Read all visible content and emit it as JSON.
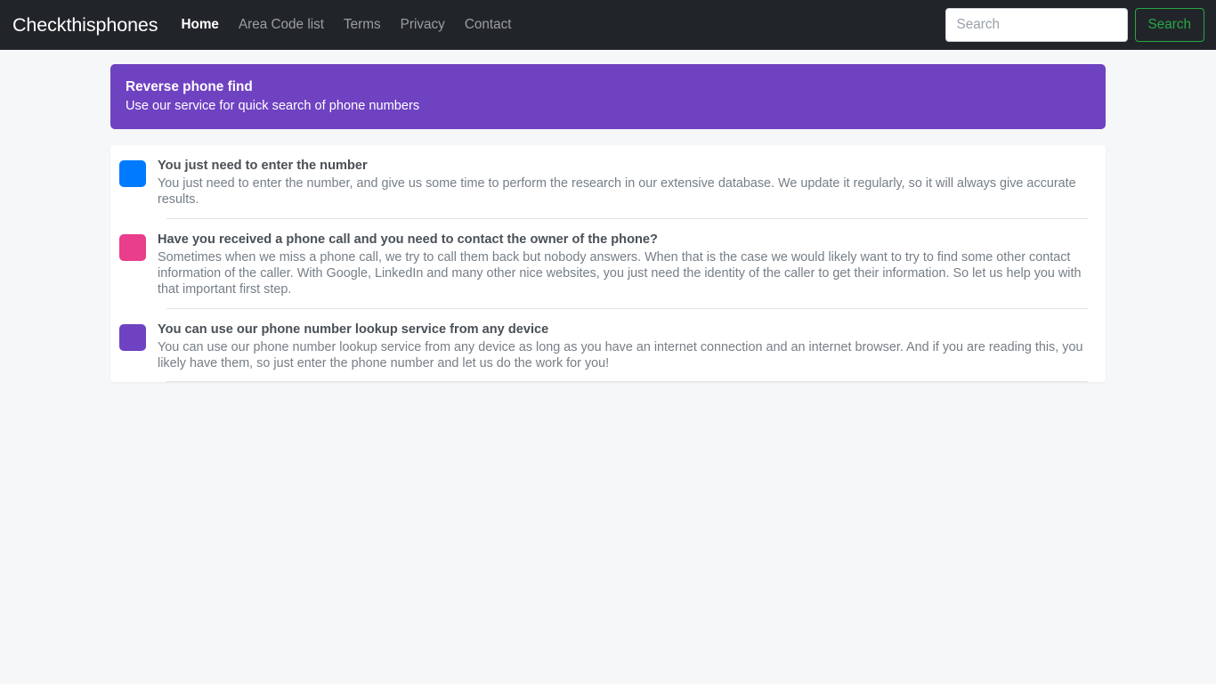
{
  "navbar": {
    "brand": "Checkthisphones",
    "links": [
      {
        "label": "Home",
        "active": true
      },
      {
        "label": "Area Code list",
        "active": false
      },
      {
        "label": "Terms",
        "active": false
      },
      {
        "label": "Privacy",
        "active": false
      },
      {
        "label": "Contact",
        "active": false
      }
    ],
    "search": {
      "value": "",
      "placeholder": "Search",
      "button_label": "Search"
    },
    "background_color": "#212529",
    "button_color": "#28a745"
  },
  "banner": {
    "title": "Reverse phone find",
    "subtitle": "Use our service for quick search of phone numbers",
    "background_color": "#6f42c1"
  },
  "card": {
    "blocks": [
      {
        "swatch_color": "#007bff",
        "swatch_name": "blue",
        "title": "You just need to enter the number",
        "text": "You just need to enter the number, and give us some time to perform the research in our extensive database. We update it regularly, so it will always give accurate results."
      },
      {
        "swatch_color": "#e83e8c",
        "swatch_name": "pink",
        "title": "Have you received a phone call and you need to contact the owner of the phone?",
        "text": "Sometimes when we miss a phone call, we try to call them back but nobody answers. When that is the case we would likely want to try to find some other contact information of the caller. With Google, LinkedIn and many other nice websites, you just need the identity of the caller to get their information. So let us help you with that important first step."
      },
      {
        "swatch_color": "#6f42c1",
        "swatch_name": "purple",
        "title": "You can use our phone number lookup service from any device",
        "text": "You can use our phone number lookup service from any device as long as you have an internet connection and an internet browser. And if you are reading this, you likely have them, so just enter the phone number and let us do the work for you!"
      }
    ]
  }
}
